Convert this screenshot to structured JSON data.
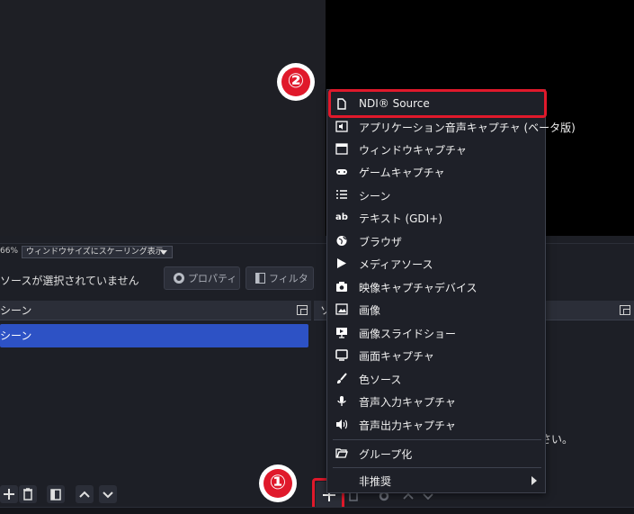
{
  "scale_bar": {
    "zoom": "66%",
    "scaling_mode": "ウィンドウサイズにスケーリング表示"
  },
  "context_bar": {
    "no_source": "ソースが選択されていません",
    "properties_label": "プロパティ",
    "filters_label": "フィルタ"
  },
  "scenes": {
    "title": "シーン",
    "items": [
      "シーン"
    ]
  },
  "sources": {
    "title": "ソ",
    "hint": "さい。"
  },
  "menu": {
    "items": [
      {
        "label": "NDI® Source",
        "icon": "file-icon"
      },
      {
        "label": "アプリケーション音声キャプチャ (ベータ版)",
        "icon": "app-audio-icon"
      },
      {
        "label": "ウィンドウキャプチャ",
        "icon": "window-icon"
      },
      {
        "label": "ゲームキャプチャ",
        "icon": "gamepad-icon"
      },
      {
        "label": "シーン",
        "icon": "list-icon"
      },
      {
        "label": "テキスト (GDI+)",
        "icon": "text-ab-icon"
      },
      {
        "label": "ブラウザ",
        "icon": "globe-icon"
      },
      {
        "label": "メディアソース",
        "icon": "play-icon"
      },
      {
        "label": "映像キャプチャデバイス",
        "icon": "camera-icon"
      },
      {
        "label": "画像",
        "icon": "image-icon"
      },
      {
        "label": "画像スライドショー",
        "icon": "slideshow-icon"
      },
      {
        "label": "画面キャプチャ",
        "icon": "monitor-icon"
      },
      {
        "label": "色ソース",
        "icon": "brush-icon"
      },
      {
        "label": "音声入力キャプチャ",
        "icon": "microphone-icon"
      },
      {
        "label": "音声出力キャプチャ",
        "icon": "speaker-icon"
      }
    ],
    "group_label": "グループ化",
    "deprecated_label": "非推奨"
  },
  "badges": {
    "one": "①",
    "two": "②"
  },
  "colors": {
    "accent_blue": "#2d52c5",
    "highlight_red": "#e0192b",
    "panel_bg": "#1d1f26",
    "canvas_bg": "#000000"
  }
}
